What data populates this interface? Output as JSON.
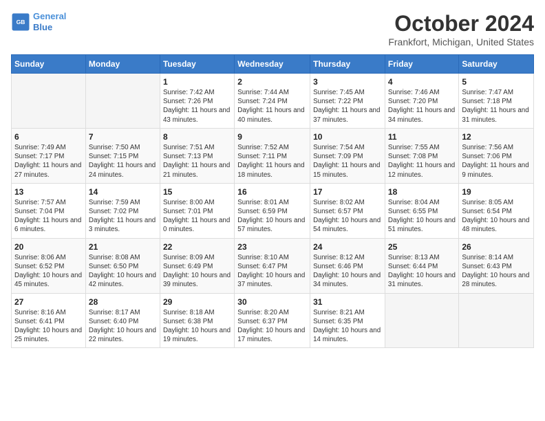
{
  "header": {
    "logo_line1": "General",
    "logo_line2": "Blue",
    "month_title": "October 2024",
    "location": "Frankfort, Michigan, United States"
  },
  "weekdays": [
    "Sunday",
    "Monday",
    "Tuesday",
    "Wednesday",
    "Thursday",
    "Friday",
    "Saturday"
  ],
  "weeks": [
    [
      {
        "day": "",
        "info": ""
      },
      {
        "day": "",
        "info": ""
      },
      {
        "day": "1",
        "info": "Sunrise: 7:42 AM\nSunset: 7:26 PM\nDaylight: 11 hours and 43 minutes."
      },
      {
        "day": "2",
        "info": "Sunrise: 7:44 AM\nSunset: 7:24 PM\nDaylight: 11 hours and 40 minutes."
      },
      {
        "day": "3",
        "info": "Sunrise: 7:45 AM\nSunset: 7:22 PM\nDaylight: 11 hours and 37 minutes."
      },
      {
        "day": "4",
        "info": "Sunrise: 7:46 AM\nSunset: 7:20 PM\nDaylight: 11 hours and 34 minutes."
      },
      {
        "day": "5",
        "info": "Sunrise: 7:47 AM\nSunset: 7:18 PM\nDaylight: 11 hours and 31 minutes."
      }
    ],
    [
      {
        "day": "6",
        "info": "Sunrise: 7:49 AM\nSunset: 7:17 PM\nDaylight: 11 hours and 27 minutes."
      },
      {
        "day": "7",
        "info": "Sunrise: 7:50 AM\nSunset: 7:15 PM\nDaylight: 11 hours and 24 minutes."
      },
      {
        "day": "8",
        "info": "Sunrise: 7:51 AM\nSunset: 7:13 PM\nDaylight: 11 hours and 21 minutes."
      },
      {
        "day": "9",
        "info": "Sunrise: 7:52 AM\nSunset: 7:11 PM\nDaylight: 11 hours and 18 minutes."
      },
      {
        "day": "10",
        "info": "Sunrise: 7:54 AM\nSunset: 7:09 PM\nDaylight: 11 hours and 15 minutes."
      },
      {
        "day": "11",
        "info": "Sunrise: 7:55 AM\nSunset: 7:08 PM\nDaylight: 11 hours and 12 minutes."
      },
      {
        "day": "12",
        "info": "Sunrise: 7:56 AM\nSunset: 7:06 PM\nDaylight: 11 hours and 9 minutes."
      }
    ],
    [
      {
        "day": "13",
        "info": "Sunrise: 7:57 AM\nSunset: 7:04 PM\nDaylight: 11 hours and 6 minutes."
      },
      {
        "day": "14",
        "info": "Sunrise: 7:59 AM\nSunset: 7:02 PM\nDaylight: 11 hours and 3 minutes."
      },
      {
        "day": "15",
        "info": "Sunrise: 8:00 AM\nSunset: 7:01 PM\nDaylight: 11 hours and 0 minutes."
      },
      {
        "day": "16",
        "info": "Sunrise: 8:01 AM\nSunset: 6:59 PM\nDaylight: 10 hours and 57 minutes."
      },
      {
        "day": "17",
        "info": "Sunrise: 8:02 AM\nSunset: 6:57 PM\nDaylight: 10 hours and 54 minutes."
      },
      {
        "day": "18",
        "info": "Sunrise: 8:04 AM\nSunset: 6:55 PM\nDaylight: 10 hours and 51 minutes."
      },
      {
        "day": "19",
        "info": "Sunrise: 8:05 AM\nSunset: 6:54 PM\nDaylight: 10 hours and 48 minutes."
      }
    ],
    [
      {
        "day": "20",
        "info": "Sunrise: 8:06 AM\nSunset: 6:52 PM\nDaylight: 10 hours and 45 minutes."
      },
      {
        "day": "21",
        "info": "Sunrise: 8:08 AM\nSunset: 6:50 PM\nDaylight: 10 hours and 42 minutes."
      },
      {
        "day": "22",
        "info": "Sunrise: 8:09 AM\nSunset: 6:49 PM\nDaylight: 10 hours and 39 minutes."
      },
      {
        "day": "23",
        "info": "Sunrise: 8:10 AM\nSunset: 6:47 PM\nDaylight: 10 hours and 37 minutes."
      },
      {
        "day": "24",
        "info": "Sunrise: 8:12 AM\nSunset: 6:46 PM\nDaylight: 10 hours and 34 minutes."
      },
      {
        "day": "25",
        "info": "Sunrise: 8:13 AM\nSunset: 6:44 PM\nDaylight: 10 hours and 31 minutes."
      },
      {
        "day": "26",
        "info": "Sunrise: 8:14 AM\nSunset: 6:43 PM\nDaylight: 10 hours and 28 minutes."
      }
    ],
    [
      {
        "day": "27",
        "info": "Sunrise: 8:16 AM\nSunset: 6:41 PM\nDaylight: 10 hours and 25 minutes."
      },
      {
        "day": "28",
        "info": "Sunrise: 8:17 AM\nSunset: 6:40 PM\nDaylight: 10 hours and 22 minutes."
      },
      {
        "day": "29",
        "info": "Sunrise: 8:18 AM\nSunset: 6:38 PM\nDaylight: 10 hours and 19 minutes."
      },
      {
        "day": "30",
        "info": "Sunrise: 8:20 AM\nSunset: 6:37 PM\nDaylight: 10 hours and 17 minutes."
      },
      {
        "day": "31",
        "info": "Sunrise: 8:21 AM\nSunset: 6:35 PM\nDaylight: 10 hours and 14 minutes."
      },
      {
        "day": "",
        "info": ""
      },
      {
        "day": "",
        "info": ""
      }
    ]
  ]
}
